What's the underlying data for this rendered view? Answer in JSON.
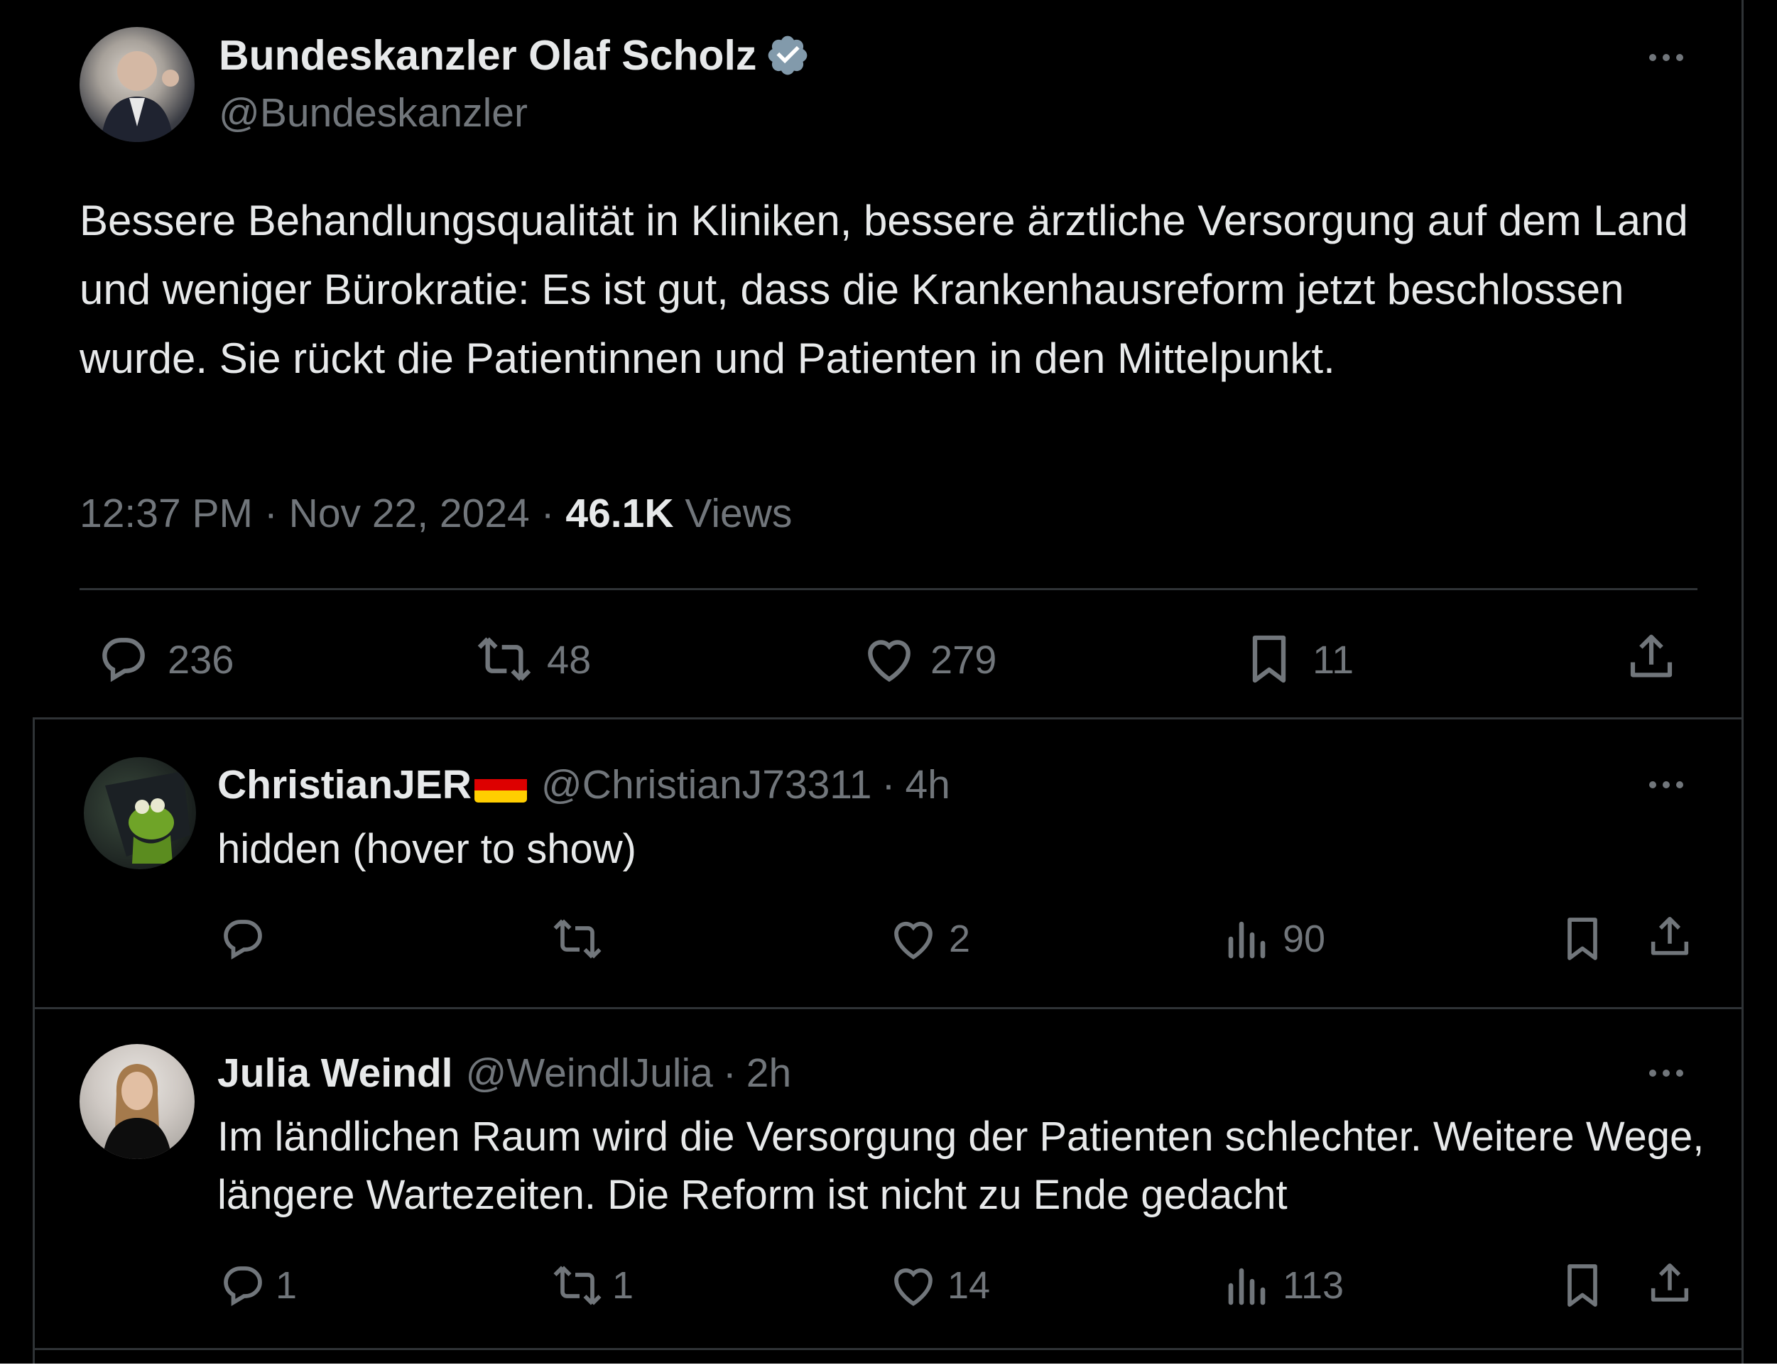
{
  "main_tweet": {
    "author_name": "Bundeskanzler Olaf Scholz",
    "handle": "@Bundeskanzler",
    "text": "Bessere Behandlungsqualität in Kliniken, bessere ärztliche Versorgung auf dem Land und weniger Bürokratie: Es ist gut, dass die Krankenhausreform jetzt beschlossen wurde. Sie rückt die Patientinnen und Patienten in den Mittelpunkt.",
    "time": "12:37 PM",
    "date": "Nov 22, 2024",
    "views_count": "46.1K",
    "views_label": "Views",
    "replies": "236",
    "reposts": "48",
    "likes": "279",
    "bookmarks": "11"
  },
  "replies": [
    {
      "author_name": "ChristianJER",
      "handle": "@ChristianJ73311",
      "age": "4h",
      "text": "hidden (hover to show)",
      "replies": "",
      "reposts": "",
      "likes": "2",
      "views": "90"
    },
    {
      "author_name": "Julia Weindl",
      "handle": "@WeindlJulia",
      "age": "2h",
      "text": "Im ländlichen Raum wird die Versorgung der Patienten schlechter. Weitere Wege, längere Wartezeiten. Die Reform ist nicht zu Ende gedacht",
      "replies": "1",
      "reposts": "1",
      "likes": "14",
      "views": "113"
    }
  ],
  "separator": "·",
  "colors": {
    "background": "#000000",
    "text": "#e7e9ea",
    "muted": "#71767b",
    "divider": "#2f3336",
    "verified": "#829aab"
  }
}
